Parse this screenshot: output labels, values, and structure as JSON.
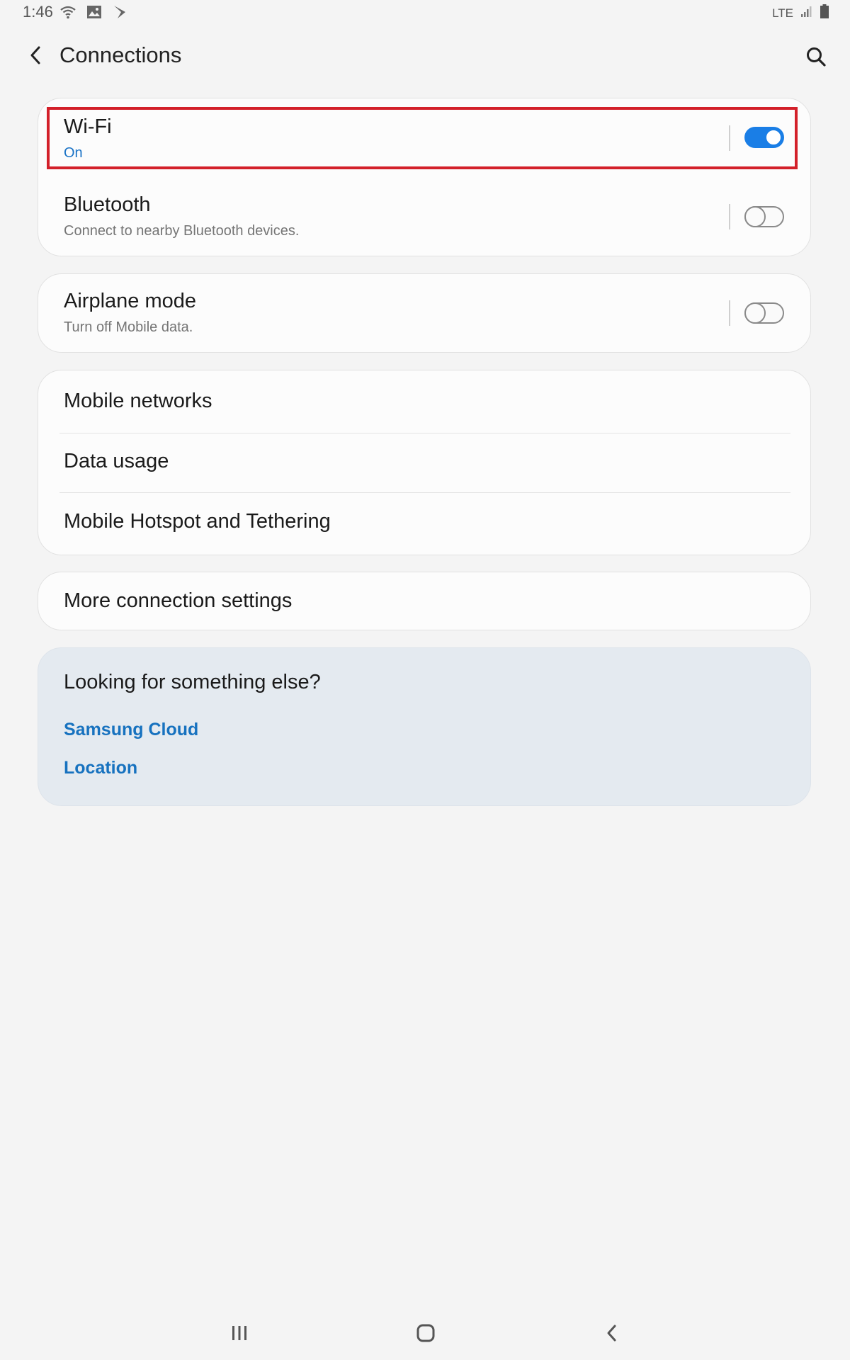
{
  "status_bar": {
    "time": "1:46",
    "left_icons": [
      "wifi-icon",
      "gallery-icon",
      "sprint-icon"
    ],
    "network_type": "LTE",
    "right_icons": [
      "signal-icon",
      "battery-icon"
    ]
  },
  "header": {
    "title": "Connections",
    "back_icon": "back-arrow-icon",
    "search_icon": "search-icon"
  },
  "connections": {
    "wifi": {
      "title": "Wi-Fi",
      "subtitle": "On",
      "enabled": true
    },
    "bluetooth": {
      "title": "Bluetooth",
      "subtitle": "Connect to nearby Bluetooth devices.",
      "enabled": false
    },
    "airplane": {
      "title": "Airplane mode",
      "subtitle": "Turn off Mobile data.",
      "enabled": false
    }
  },
  "network_items": [
    "Mobile networks",
    "Data usage",
    "Mobile Hotspot and Tethering"
  ],
  "more_settings": "More connection settings",
  "suggestions": {
    "heading": "Looking for something else?",
    "links": [
      "Samsung Cloud",
      "Location"
    ]
  },
  "nav_bar": {
    "icons": [
      "recents-icon",
      "home-icon",
      "back-icon"
    ]
  },
  "colors": {
    "accent": "#1a7ee6",
    "link": "#1772bf",
    "highlight": "#d3202a",
    "background": "#f4f4f4",
    "suggestion_card": "#e4eaf0"
  }
}
